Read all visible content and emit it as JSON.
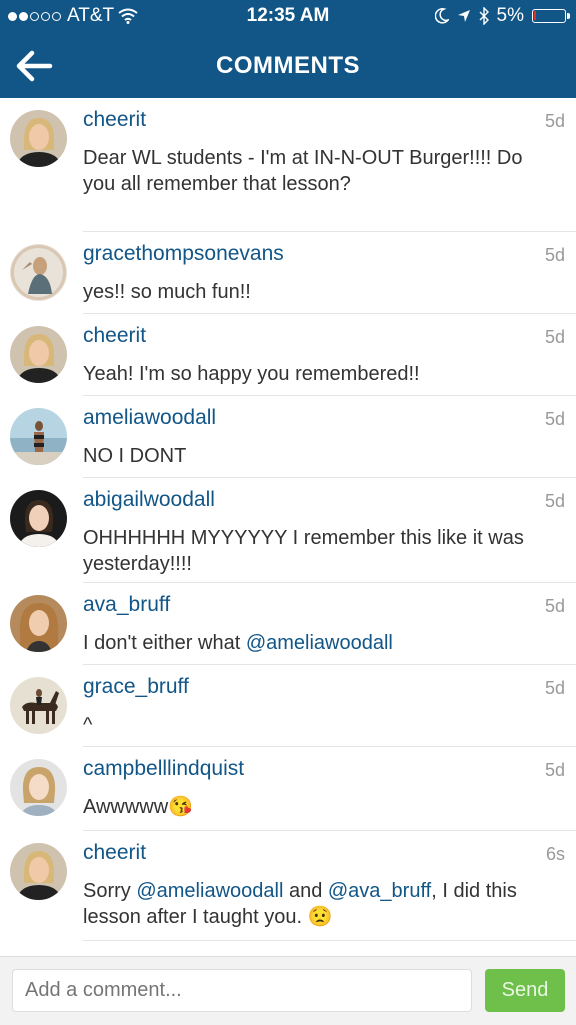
{
  "status_bar": {
    "carrier": "AT&T",
    "time": "12:35 AM",
    "battery_percent": "5%",
    "battery_level": 0.05,
    "signal_full": 2,
    "signal_total": 5
  },
  "nav": {
    "title": "COMMENTS"
  },
  "comments": [
    {
      "user": "cheerit",
      "time": "5d",
      "text": "Dear WL students - I'm at IN-N-OUT Burger!!!! Do you all remember that lesson?"
    },
    {
      "user": "gracethompsonevans",
      "time": "5d",
      "text": "yes!! so much fun!!"
    },
    {
      "user": "cheerit",
      "time": "5d",
      "text": "Yeah! I'm so happy you remembered!!"
    },
    {
      "user": "ameliawoodall",
      "time": "5d",
      "text": "NO I DONT"
    },
    {
      "user": "abigailwoodall",
      "time": "5d",
      "text": "OHHHHHH MYYYYYY I remember this like it was yesterday!!!!"
    },
    {
      "user": "ava_bruff",
      "time": "5d",
      "text_prefix": "I don't either what ",
      "mention1": "@ameliawoodall"
    },
    {
      "user": "grace_bruff",
      "time": "5d",
      "text": "^"
    },
    {
      "user": "campbelllindquist",
      "time": "5d",
      "text": "Awwwww",
      "emoji": "😘"
    },
    {
      "user": "cheerit",
      "time": "6s",
      "text_prefix": "Sorry ",
      "mention1": "@ameliawoodall",
      "text_mid": " and ",
      "mention2": "@ava_bruff",
      "text_suffix": ", I did this lesson after I taught you. ",
      "emoji": "😟"
    }
  ],
  "footer": {
    "placeholder": "Add a comment...",
    "send_label": "Send"
  },
  "colors": {
    "header": "#125688",
    "username": "#125688",
    "send": "#6ec04b"
  }
}
